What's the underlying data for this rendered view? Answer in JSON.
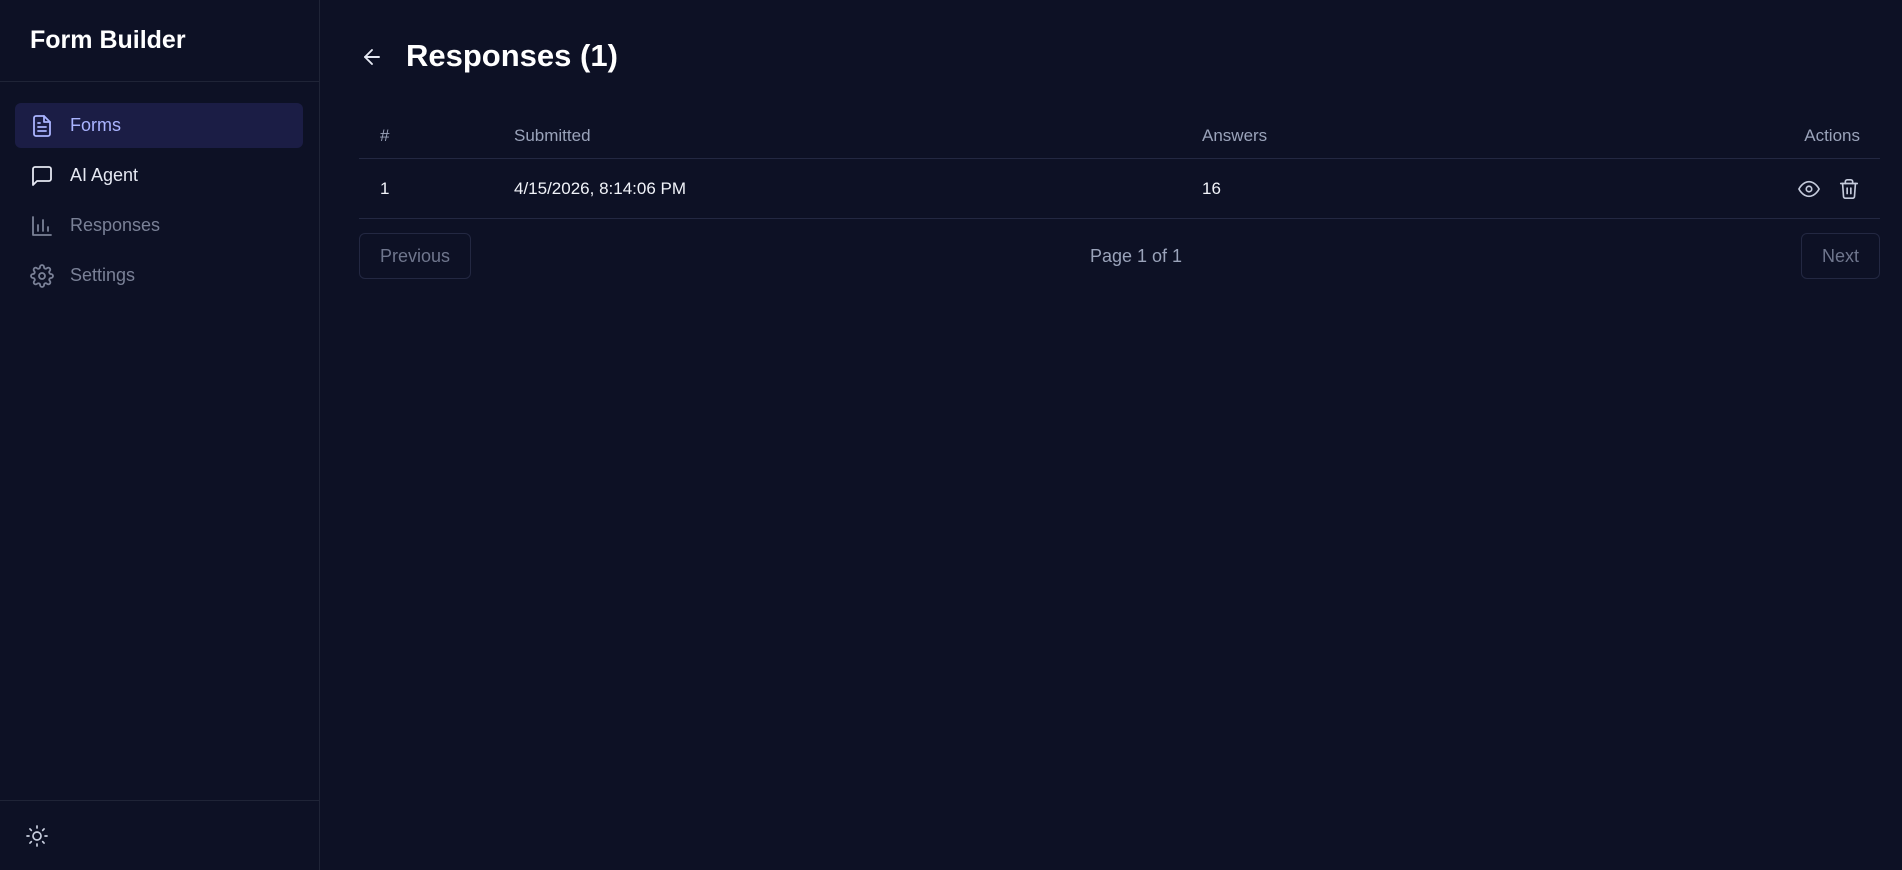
{
  "app": {
    "title": "Form Builder"
  },
  "sidebar": {
    "items": [
      {
        "label": "Forms",
        "icon": "file-text-icon",
        "state": "active"
      },
      {
        "label": "AI Agent",
        "icon": "chat-icon",
        "state": "normal"
      },
      {
        "label": "Responses",
        "icon": "bar-chart-icon",
        "state": "muted"
      },
      {
        "label": "Settings",
        "icon": "gear-icon",
        "state": "muted"
      }
    ],
    "footer_icon": "sun-icon"
  },
  "header": {
    "title": "Responses (1)",
    "back_icon": "arrow-left-icon"
  },
  "table": {
    "columns": [
      "#",
      "Submitted",
      "Answers",
      "Actions"
    ],
    "rows": [
      {
        "num": "1",
        "submitted": "4/15/2026, 8:14:06 PM",
        "answers": "16",
        "actions": [
          "eye-icon",
          "trash-icon"
        ]
      }
    ]
  },
  "pagination": {
    "previous_label": "Previous",
    "info": "Page 1 of 1",
    "next_label": "Next"
  },
  "colors": {
    "background": "#0d1125",
    "active_bg": "#1b1d45",
    "active_fg": "#aab4ff",
    "border": "#232842"
  }
}
